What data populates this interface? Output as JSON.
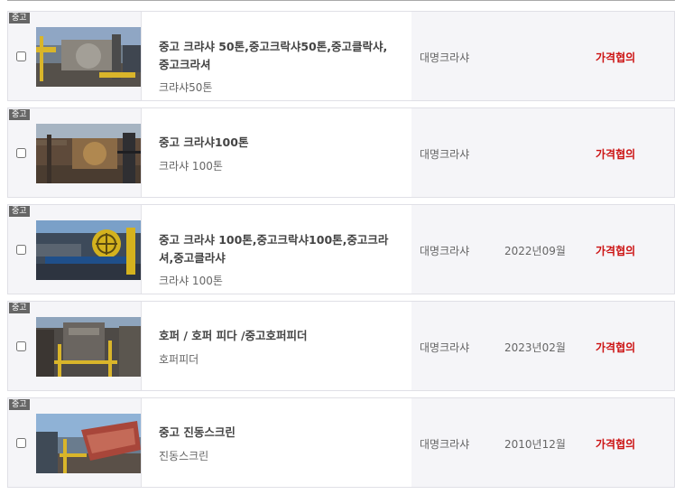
{
  "listings": [
    {
      "badge": "중고",
      "title": "중고 크랴샤 50톤,중고크락샤50톤,중고클락샤,중고크라셔",
      "subtitle": "크랴샤50톤",
      "seller": "대명크라샤",
      "year": "",
      "price": "가격협의"
    },
    {
      "badge": "중고",
      "title": "중고 크라샤100톤",
      "subtitle": "크라샤 100톤",
      "seller": "대명크라샤",
      "year": "",
      "price": "가격협의"
    },
    {
      "badge": "중고",
      "title": "중고 크라샤 100톤,중고크락샤100톤,중고크라셔,중고클라샤",
      "subtitle": "크라샤 100톤",
      "seller": "대명크라샤",
      "year": "2022년09월",
      "price": "가격협의"
    },
    {
      "badge": "중고",
      "title": "호퍼 / 호퍼 피다 /중고호퍼피더",
      "subtitle": "호퍼피더",
      "seller": "대명크라샤",
      "year": "2023년02월",
      "price": "가격협의"
    },
    {
      "badge": "중고",
      "title": "중고 진동스크린",
      "subtitle": "진동스크린",
      "seller": "대명크라샤",
      "year": "2010년12월",
      "price": "가격협의"
    }
  ],
  "colors": {
    "price": "#cc1111",
    "badge_bg": "#666666",
    "row_bg": "#f5f5f8"
  }
}
